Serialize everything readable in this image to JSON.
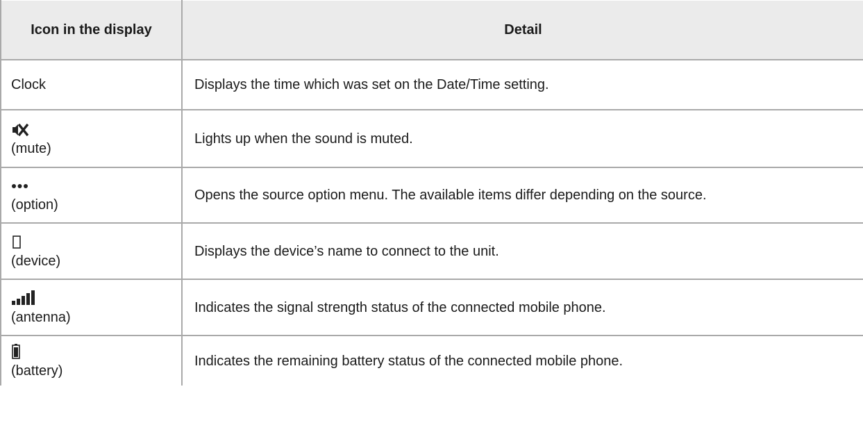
{
  "table": {
    "headers": [
      "Icon in the display",
      "Detail"
    ],
    "rows": [
      {
        "icon": "",
        "icon_name": "",
        "label": "Clock",
        "detail": "Displays the time which was set on the Date/Time setting."
      },
      {
        "icon": "mute-icon",
        "label": "(mute)",
        "detail": "Lights up when the sound is muted."
      },
      {
        "icon": "option-icon",
        "label": "(option)",
        "detail": "Opens the source option menu. The available items differ depending on the source."
      },
      {
        "icon": "device-icon",
        "label": "(device)",
        "detail": "Displays the device’s name to connect to the unit."
      },
      {
        "icon": "antenna-icon",
        "label": "(antenna)",
        "detail": "Indicates the signal strength status of the connected mobile phone."
      },
      {
        "icon": "battery-icon",
        "label": "(battery)",
        "detail": "Indicates the remaining battery status of the connected mobile phone."
      }
    ]
  }
}
